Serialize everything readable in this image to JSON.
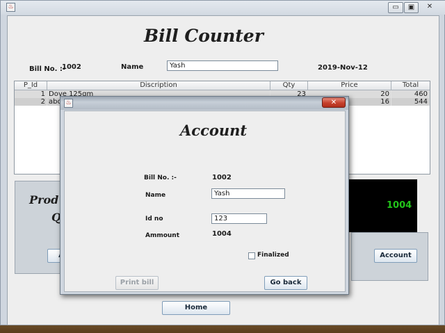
{
  "window": {
    "icon": "java-cup-icon",
    "controls": {
      "minimize": "▭",
      "maximize": "▣",
      "close": "✕"
    }
  },
  "main": {
    "title": "Bill Counter",
    "bill_label": "Bill No. :-",
    "bill_no": "1002",
    "name_label": "Name",
    "name_value": "Yash",
    "date": "2019-Nov-12",
    "table": {
      "columns": [
        "P_Id",
        "Discription",
        "Qty",
        "Price",
        "Total"
      ],
      "rows": [
        [
          "1",
          "Dove 125gm",
          "23",
          "20",
          "460"
        ],
        [
          "2",
          "abc",
          "",
          "16",
          "544"
        ]
      ]
    },
    "left_panel_text1": "Prod",
    "left_panel_text2": "Q",
    "left_button_partial": "A",
    "total_display": "1004",
    "account_button": "Account",
    "home_button": "Home"
  },
  "dialog": {
    "close_glyph": "✕",
    "title": "Account",
    "bill_label": "Bill No. :-",
    "bill_no": "1002",
    "name_label": "Name",
    "name_value": "Yash",
    "id_label": "Id no",
    "id_value": "123",
    "amount_label": "Ammount",
    "amount_value": "1004",
    "finalized_label": "Finalized",
    "finalized_checked": false,
    "print_button": "Print bill",
    "goback_button": "Go back"
  },
  "colors": {
    "total_bg": "#000000",
    "total_fg": "#22c41a",
    "close_red": "#c6402c"
  }
}
